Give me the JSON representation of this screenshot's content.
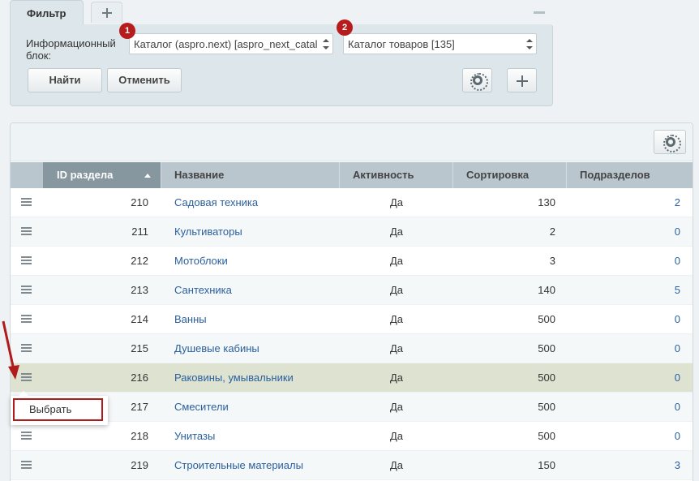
{
  "filter": {
    "tab_label": "Фильтр",
    "field_label": "Информационный блок:",
    "iblock_type": "Каталог (aspro.next) [aspro_next_catal",
    "iblock": "Каталог товаров [135]",
    "badge_1": "1",
    "badge_2": "2",
    "find_label": "Найти",
    "cancel_label": "Отменить"
  },
  "grid": {
    "columns": [
      "ID раздела",
      "Название",
      "Активность",
      "Сортировка",
      "Подразделов"
    ],
    "rows": [
      {
        "id": "210",
        "name": "Садовая техника",
        "active": "Да",
        "sort": "130",
        "sub": "2"
      },
      {
        "id": "211",
        "name": "Культиваторы",
        "active": "Да",
        "sort": "2",
        "sub": "0"
      },
      {
        "id": "212",
        "name": "Мотоблоки",
        "active": "Да",
        "sort": "3",
        "sub": "0"
      },
      {
        "id": "213",
        "name": "Сантехника",
        "active": "Да",
        "sort": "140",
        "sub": "5"
      },
      {
        "id": "214",
        "name": "Ванны",
        "active": "Да",
        "sort": "500",
        "sub": "0"
      },
      {
        "id": "215",
        "name": "Душевые кабины",
        "active": "Да",
        "sort": "500",
        "sub": "0"
      },
      {
        "id": "216",
        "name": "Раковины, умывальники",
        "active": "Да",
        "sort": "500",
        "sub": "0"
      },
      {
        "id": "217",
        "name": "Смесители",
        "active": "Да",
        "sort": "500",
        "sub": "0"
      },
      {
        "id": "218",
        "name": "Унитазы",
        "active": "Да",
        "sort": "500",
        "sub": "0"
      },
      {
        "id": "219",
        "name": "Строительные материалы",
        "active": "Да",
        "sort": "150",
        "sub": "3"
      }
    ]
  },
  "context_menu": {
    "select_label": "Выбрать"
  },
  "colors": {
    "accent_red": "#b01c1c",
    "link_blue": "#2a5f9e",
    "highlight_row": "#dde3d0"
  }
}
